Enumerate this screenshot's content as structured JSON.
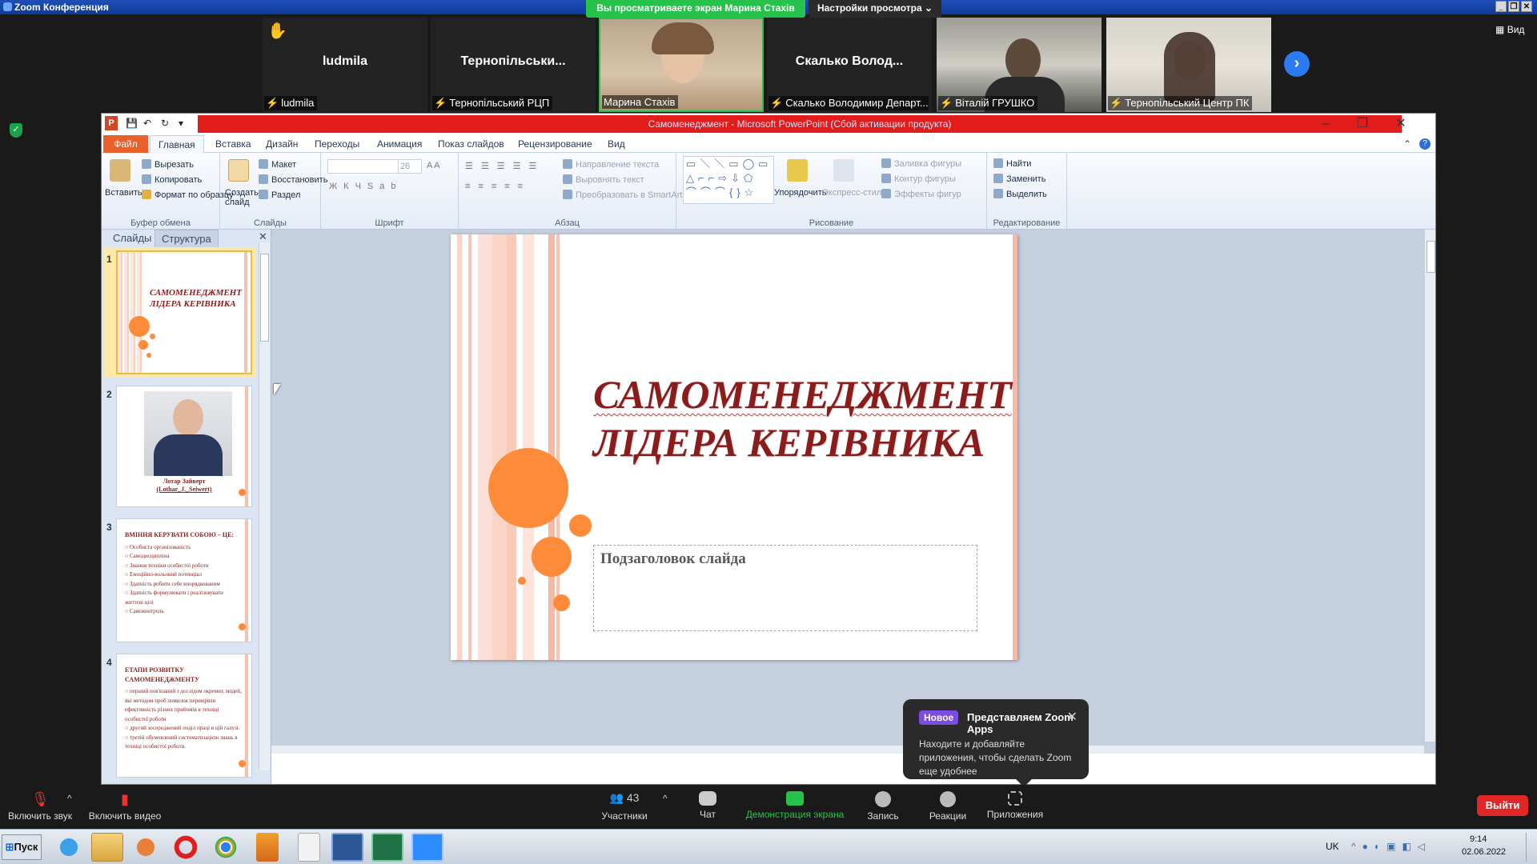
{
  "zoom": {
    "window_title": "Zoom Конференция",
    "sharing_banner": "Вы просматриваете экран Марина Стахів",
    "view_settings": "Настройки просмотра",
    "view_button": "Вид",
    "participants": [
      {
        "name": "ludmila",
        "label": "ludmila",
        "raised_hand": true
      },
      {
        "name": "Тернопільськи...",
        "label": "Тернопільський РЦП"
      },
      {
        "name": "",
        "label": "Марина Стахів",
        "video": true
      },
      {
        "name": "Скалько Волод...",
        "label": "Скалько Володимир Департ..."
      },
      {
        "name": "",
        "label": "Віталій ГРУШКО",
        "video": true
      },
      {
        "name": "",
        "label": "Тернопільський Центр ПК",
        "video": true
      }
    ]
  },
  "ppt": {
    "title": "Самоменеджмент - Microsoft PowerPoint (Сбой активации продукта)",
    "tabs": [
      "Файл",
      "Главная",
      "Вставка",
      "Дизайн",
      "Переходы",
      "Анимация",
      "Показ слайдов",
      "Рецензирование",
      "Вид"
    ],
    "ribbon": {
      "clipboard": {
        "paste": "Вставить",
        "cut": "Вырезать",
        "copy": "Копировать",
        "format_painter": "Формат по образцу",
        "label": "Буфер обмена"
      },
      "slides": {
        "new_slide": "Создать слайд",
        "layout": "Макет",
        "reset": "Восстановить",
        "section": "Раздел",
        "label": "Слайды"
      },
      "font": {
        "size": "26",
        "label": "Шрифт"
      },
      "paragraph": {
        "text_direction": "Направление текста",
        "align_text": "Выровнять текст",
        "smartart": "Преобразовать в SmartArt",
        "label": "Абзац"
      },
      "drawing": {
        "arrange": "Упорядочить",
        "quick_styles": "Экспресс-стили",
        "shape_fill": "Заливка фигуры",
        "shape_outline": "Контур фигуры",
        "shape_effects": "Эффекты фигур",
        "label": "Рисование"
      },
      "editing": {
        "find": "Найти",
        "replace": "Заменить",
        "select": "Выделить",
        "label": "Редактирование"
      }
    },
    "pane_tabs": [
      "Слайды",
      "Структура"
    ],
    "thumbnails": [
      {
        "num": "1",
        "title": "Самоменеджмент лідера керівника"
      },
      {
        "num": "2",
        "caption_line1": "Лотар Зайверт",
        "caption_line2": "(Lothar_J._Seiwert)"
      },
      {
        "num": "3",
        "heading": "Вміння керувати собою – це:",
        "items": [
          "Особиста організованість",
          "Самодисципліна",
          "Знання техніки особистої роботи",
          "Емоційно-вольовий потенціал",
          "Здатність робити себе впорядкованим",
          "Здатність формулювати і реалізовувати життєві цілі",
          "Самоконтроль"
        ]
      },
      {
        "num": "4",
        "heading": "Етапи розвитку самоменеджменту",
        "items": [
          "перший пов'язаний з дослідом окремих людей, які методом проб помилок перевіряли ефективність різних прийомів в техніці особистої роботи",
          "другий зосереджений поділ праці в цій галузі.",
          "третій обумовлений систематизацією знань в техніці особистої роботи."
        ]
      }
    ],
    "slide": {
      "title_line1": "Самоменеджмент",
      "title_line2": "лідера керівника",
      "subtitle_placeholder": "Подзаголовок слайда"
    }
  },
  "popup": {
    "badge": "Новое",
    "title": "Представляем Zoom Apps",
    "body": "Находите и добавляйте приложения, чтобы сделать Zoom еще удобнее"
  },
  "toolbar": {
    "audio": "Включить звук",
    "video": "Включить видео",
    "participants": "Участники",
    "participants_count": "43",
    "chat": "Чат",
    "share": "Демонстрация экрана",
    "record": "Запись",
    "reactions": "Реакции",
    "apps": "Приложения",
    "leave": "Выйти"
  },
  "taskbar": {
    "start": "Пуск",
    "lang": "UK",
    "time": "9:14",
    "date": "02.06.2022"
  },
  "colors": {
    "zoom_green": "#27c24c",
    "ppt_red_title": "#e21b1b",
    "slide_title": "#8a1c1c",
    "circle_orange": "#fd8b3a",
    "leave_red": "#e02828"
  }
}
